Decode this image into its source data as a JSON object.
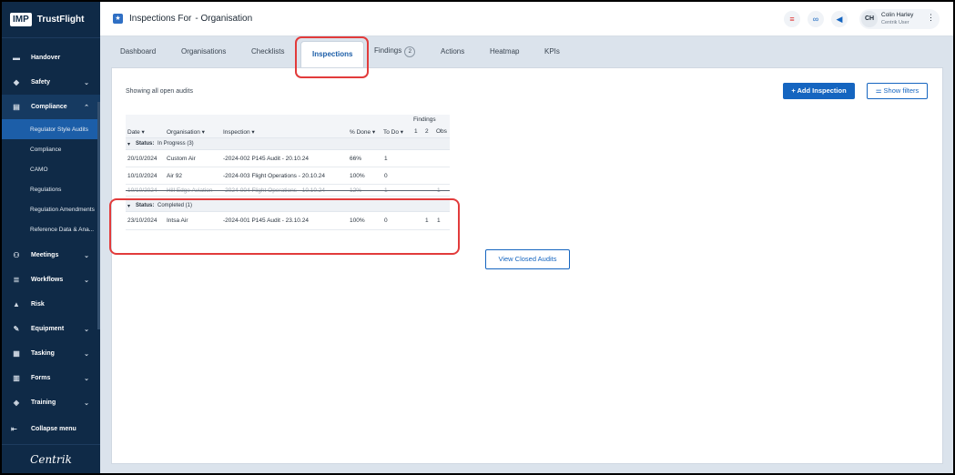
{
  "brand": {
    "box": "IMP",
    "name": "TrustFlight"
  },
  "sidebar": {
    "items": [
      {
        "label": "Handover",
        "icon": "handover-icon",
        "glyph": "▬"
      },
      {
        "label": "Safety",
        "icon": "shield-icon",
        "glyph": "◆"
      },
      {
        "label": "Compliance",
        "icon": "document-icon",
        "glyph": "▤"
      }
    ],
    "compliance_sub": [
      "Regulator Style Audits",
      "Compliance",
      "CAMO",
      "Regulations",
      "Regulation Amendments",
      "Reference Data & Ana..."
    ],
    "items2": [
      {
        "label": "Meetings",
        "icon": "meetings-icon",
        "glyph": "⚇"
      },
      {
        "label": "Workflows",
        "icon": "workflows-icon",
        "glyph": "≣"
      },
      {
        "label": "Risk",
        "icon": "risk-icon",
        "glyph": "▲"
      },
      {
        "label": "Equipment",
        "icon": "wrench-icon",
        "glyph": "✎"
      },
      {
        "label": "Tasking",
        "icon": "tasking-icon",
        "glyph": "▦"
      },
      {
        "label": "Forms",
        "icon": "forms-icon",
        "glyph": "▥"
      },
      {
        "label": "Training",
        "icon": "graduation-cap-icon",
        "glyph": "◈"
      }
    ],
    "collapse_label": "Collapse menu",
    "footer_logo": "Centrik"
  },
  "header": {
    "title": "Inspections For",
    "subtitle": "- Organisation",
    "user_initials": "CH",
    "user_name": "Colin Harley",
    "user_role": "Centrik User"
  },
  "tabs": [
    {
      "label": "Dashboard"
    },
    {
      "label": "Organisations"
    },
    {
      "label": "Checklists"
    },
    {
      "label": "Inspections"
    },
    {
      "label": "Findings",
      "badge": "2"
    },
    {
      "label": "Actions"
    },
    {
      "label": "Heatmap"
    },
    {
      "label": "KPIs"
    }
  ],
  "main": {
    "showing_text": "Showing all open audits",
    "add_button": "+ Add Inspection",
    "filters_button": "Show filters",
    "view_closed_button": "View Closed Audits"
  },
  "grid": {
    "findings_header": "Findings",
    "columns": [
      "Date ▾",
      "Organisation ▾",
      "Inspection ▾",
      "% Done ▾",
      "To Do ▾",
      "1",
      "2",
      "Obs"
    ],
    "group_in_progress": {
      "label": "Status:",
      "value": "In Progress (3)"
    },
    "group_completed": {
      "label": "Status:",
      "value": "Completed (1)"
    },
    "rows": [
      {
        "date": "20/10/2024",
        "org": "Custom Air",
        "insp": "-2024-002  P145 Audit - 20.10.24",
        "done": "66%",
        "todo": "1",
        "f1": "",
        "f2": "",
        "obs": ""
      },
      {
        "date": "10/10/2024",
        "org": "Air 92",
        "insp": "-2024-003  Flight Operations - 20.10.24",
        "done": "100%",
        "todo": "0",
        "f1": "",
        "f2": "",
        "obs": ""
      },
      {
        "date": "10/10/2024",
        "org": "Hill Edge Aviation",
        "insp": "-2024-004  Flight Operations - 10.10.24",
        "done": "12%",
        "todo": "1",
        "f1": "",
        "f2": "",
        "obs": "1"
      }
    ],
    "completed_rows": [
      {
        "date": "23/10/2024",
        "org": "Intsa Air",
        "insp": "-2024-001  P145 Audit - 23.10.24",
        "done": "100%",
        "todo": "0",
        "f1": "",
        "f2": "1",
        "obs": "1"
      }
    ]
  }
}
